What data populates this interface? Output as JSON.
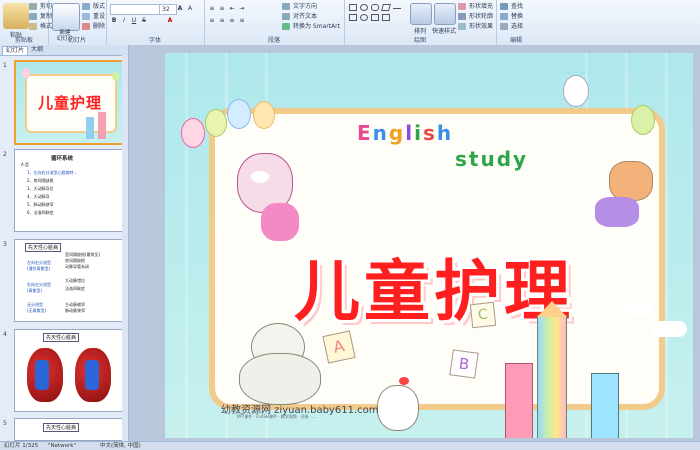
{
  "ribbon": {
    "clipboard": {
      "paste": "粘贴",
      "cut": "剪切",
      "copy": "复制",
      "format_painter": "格式刷",
      "label": "剪贴板"
    },
    "slides": {
      "new_slide": "新建\n幻灯片",
      "layout": "版式",
      "reset": "重设",
      "delete": "删除",
      "label": "幻灯片"
    },
    "font": {
      "font_name": "",
      "font_size": "32",
      "label": "字体"
    },
    "paragraph": {
      "text_direction": "文字方向",
      "align_text": "对齐文本",
      "smartart": "转换为 SmartArt",
      "label": "段落"
    },
    "drawing": {
      "arrange": "排列",
      "quick_styles": "快速样式",
      "shape_fill": "形状填充",
      "shape_outline": "形状轮廓",
      "shape_effects": "形状效果",
      "label": "绘图"
    },
    "editing": {
      "find": "查找",
      "replace": "替换",
      "select": "选择",
      "label": "编辑"
    }
  },
  "panel": {
    "tabs": [
      "幻灯片",
      "大纲"
    ],
    "slide_numbers": [
      "1",
      "2",
      "3",
      "4",
      "5"
    ],
    "thumb1_title": "儿童护理",
    "thumb2": {
      "title": "循环系统",
      "section": "A.型",
      "items": [
        "1、左向右分流型心脏病特...",
        "2、房间隔缺损",
        "3、大动脉导位",
        "4、大动脉导",
        "5、肺动脉狭窄",
        "6、法洛四联症"
      ]
    },
    "thumb3": {
      "title": "先天性心脏病",
      "items": [
        "左向右分流型",
        "(潜伏青紫型)",
        "室间隔缺损(最常见)",
        "房间隔缺损",
        "动脉导管未闭",
        "右向左分流型",
        "(青紫型)",
        "大动脉错位",
        "法洛四联症",
        "无分流型",
        "(无青紫型)",
        "主动脉缩窄",
        "肺动脉狭窄"
      ]
    },
    "thumb4_title": "先天性心脏病",
    "thumb5_title": "先天性心脏病"
  },
  "slide": {
    "title": "儿童护理",
    "english": "English",
    "study": "study",
    "footer": "幼教资源网 ziyuan.baby611.com",
    "footer_sub": "PPT课件  ·  FLASH课件  ·  教学视频  ·  试卷  ·  ..."
  },
  "status": {
    "slide_info": "幻灯片 1/325",
    "theme": "\"Network\"",
    "language": "中文(简体, 中国)"
  }
}
